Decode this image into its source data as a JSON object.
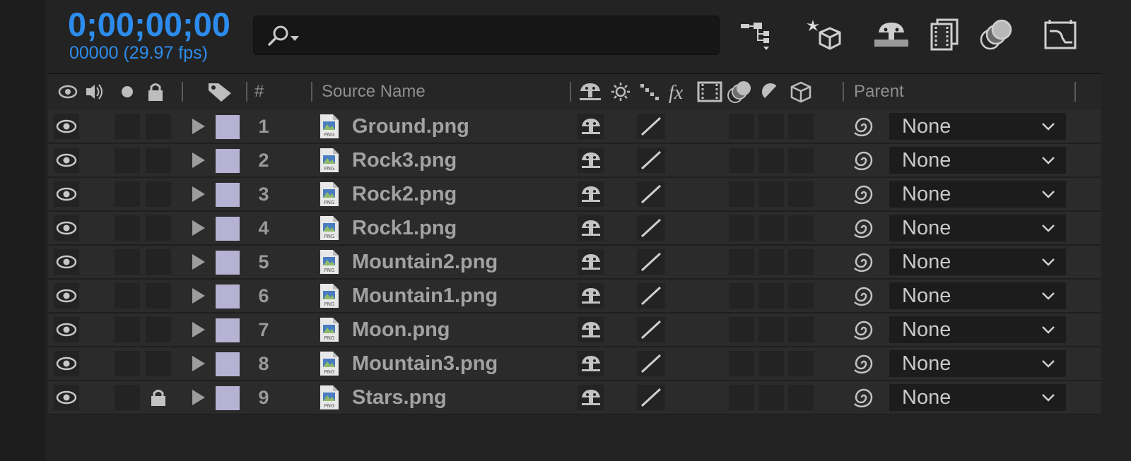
{
  "header": {
    "timecode": "0;00;00;00",
    "frames": "00000 (29.97 fps)",
    "search_icon": "search-dropdown-icon",
    "toolbar_icons": [
      "composition-flowchart-icon",
      "draft-3d-icon",
      "shy-layers-icon",
      "frame-blending-icon",
      "motion-blur-icon",
      "graph-editor-icon"
    ]
  },
  "columns": {
    "number": "#",
    "source_name": "Source Name",
    "parent": "Parent"
  },
  "colors": {
    "timecode": "#2d8ceb",
    "label": "#b6b2d4",
    "row_bg": "#2b2b2b"
  },
  "layers": [
    {
      "num": "1",
      "name": "Ground.png",
      "parent": "None",
      "locked": false
    },
    {
      "num": "2",
      "name": "Rock3.png",
      "parent": "None",
      "locked": false
    },
    {
      "num": "3",
      "name": "Rock2.png",
      "parent": "None",
      "locked": false
    },
    {
      "num": "4",
      "name": "Rock1.png",
      "parent": "None",
      "locked": false
    },
    {
      "num": "5",
      "name": "Mountain2.png",
      "parent": "None",
      "locked": false
    },
    {
      "num": "6",
      "name": "Mountain1.png",
      "parent": "None",
      "locked": false
    },
    {
      "num": "7",
      "name": "Moon.png",
      "parent": "None",
      "locked": false
    },
    {
      "num": "8",
      "name": "Mountain3.png",
      "parent": "None",
      "locked": false
    },
    {
      "num": "9",
      "name": "Stars.png",
      "parent": "None",
      "locked": true
    }
  ]
}
